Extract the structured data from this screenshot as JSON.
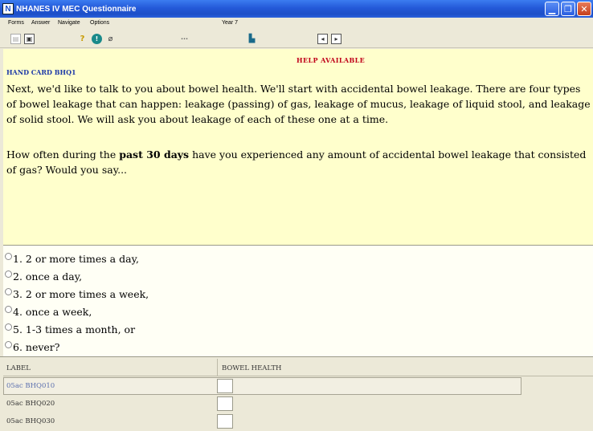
{
  "window": {
    "title": "NHANES IV MEC Questionnaire",
    "app_icon": "N",
    "buttons": {
      "minimize": "▁",
      "maximize": "❐",
      "close": "✕"
    }
  },
  "menu": {
    "items": [
      "Forms",
      "Answer",
      "Navigate",
      "Options"
    ],
    "year": "Year 7"
  },
  "toolbar": {
    "icons": [
      "page-icon",
      "copy-icon",
      "help-icon",
      "info-icon",
      "clip-icon",
      "ellipsis-icon",
      "book-icon",
      "prev-icon",
      "next-icon"
    ],
    "ellipsis": "···"
  },
  "question": {
    "help_available": "HELP AVAILABLE",
    "hand_card": "HAND CARD BHQ1",
    "intro": "Next, we'd like to talk to you about bowel health. We'll start with accidental bowel leakage. There are four types of bowel leakage that can happen: leakage (passing) of gas, leakage of mucus, leakage of liquid stool, and leakage of solid stool. We will ask you about leakage of each of these one at a time.",
    "prompt_before": "How often during the ",
    "prompt_bold": "past 30 days",
    "prompt_after": " have you experienced any amount of accidental bowel leakage that consisted of gas? Would you say..."
  },
  "options": [
    "1. 2 or more times a day,",
    "2. once a day,",
    "3. 2 or more times a week,",
    "4. once a week,",
    "5. 1-3 times a month, or",
    "6. never?"
  ],
  "grid": {
    "headers": {
      "label": "LABEL",
      "section": "BOWEL HEALTH"
    },
    "rows": [
      "05ac BHQ010",
      "05ac BHQ020",
      "05ac BHQ030"
    ]
  },
  "colors": {
    "question_bg": "#ffffcc",
    "help_red": "#c0001a",
    "hand_card_blue": "#1e3aa8",
    "titlebar_blue": "#2459d8"
  }
}
